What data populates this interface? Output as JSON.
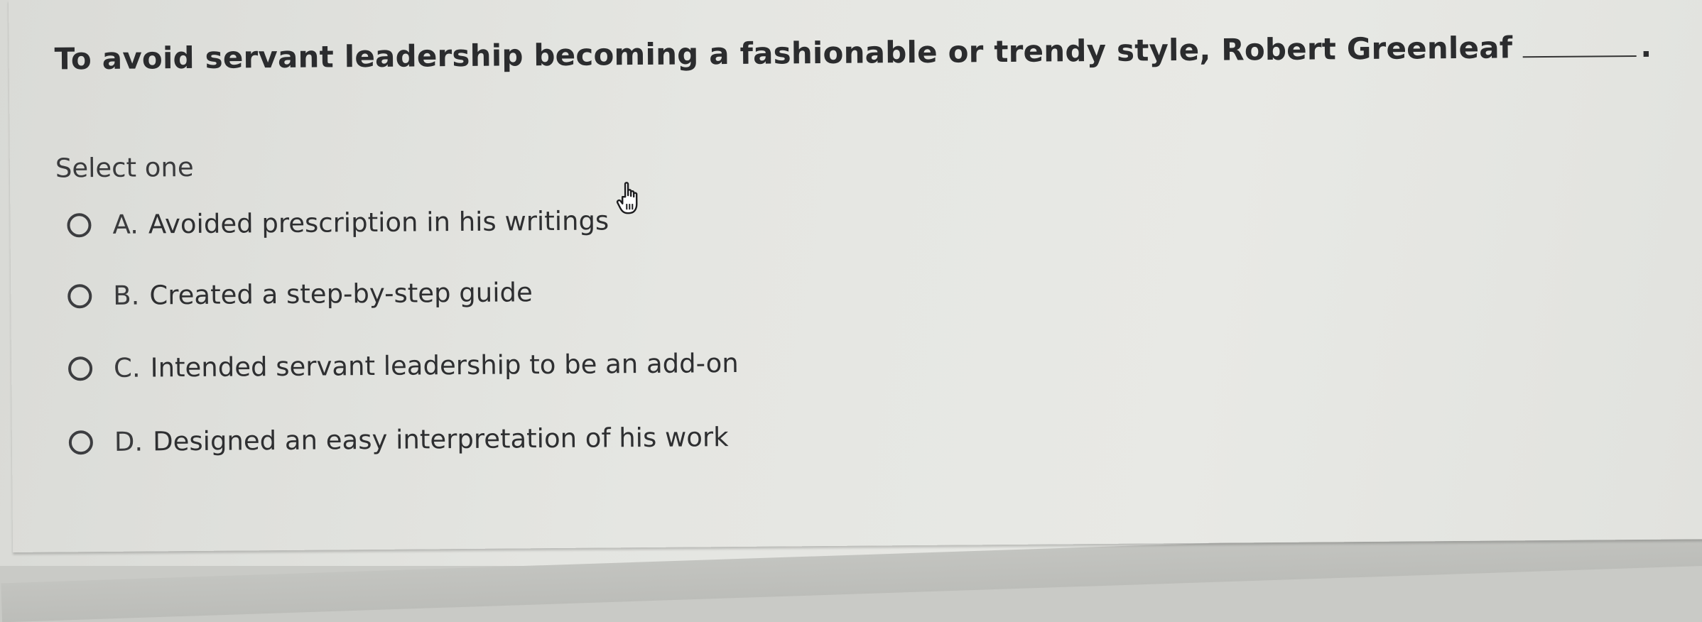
{
  "question": {
    "text": "To avoid servant leadership becoming a fashionable or trendy style, Robert Greenleaf",
    "end_punct": "."
  },
  "prompt": "Select one",
  "options": [
    {
      "letter": "A.",
      "text": "Avoided prescription in his writings"
    },
    {
      "letter": "B.",
      "text": "Created a step-by-step guide"
    },
    {
      "letter": "C.",
      "text": "Intended servant leadership to be an add-on"
    },
    {
      "letter": "D.",
      "text": "Designed an easy interpretation of his work"
    }
  ],
  "cursor_icon": "hand-pointer-icon"
}
